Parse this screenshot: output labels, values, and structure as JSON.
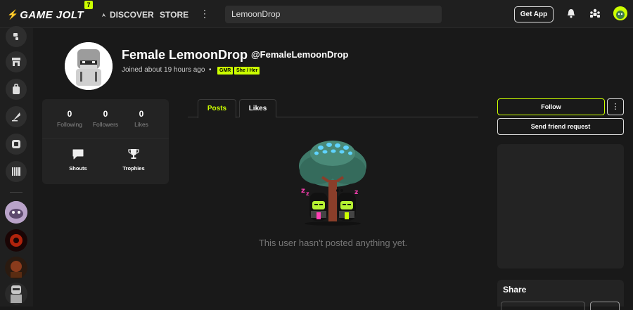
{
  "topbar": {
    "logo_text": "GAME JOLT",
    "logo_badge": "7",
    "nav_discover": "DISCOVER",
    "nav_store": "STORE",
    "nav_more": "⋮",
    "search_value": "LemoonDrop",
    "get_app": "Get App"
  },
  "profile": {
    "name": "Female LemoonDrop",
    "handle": "@FemaleLemoonDrop",
    "joined": "Joined about 19 hours ago",
    "dot": "•",
    "badges": [
      "GMR",
      "She / Her"
    ]
  },
  "stats": {
    "following_count": "0",
    "following_label": "Following",
    "followers_count": "0",
    "followers_label": "Followers",
    "likes_count": "0",
    "likes_label": "Likes",
    "shouts_label": "Shouts",
    "trophies_label": "Trophies"
  },
  "tabs": [
    {
      "label": "Posts",
      "active": true
    },
    {
      "label": "Likes",
      "active": false
    }
  ],
  "feed": {
    "empty_text": "This user hasn't posted anything yet."
  },
  "actions": {
    "follow": "Follow",
    "more": "⋮",
    "send_friend_request": "Send friend request"
  },
  "share": {
    "title": "Share"
  },
  "colors": {
    "accent": "#ccff00",
    "background": "#191919",
    "panel": "#232323"
  }
}
